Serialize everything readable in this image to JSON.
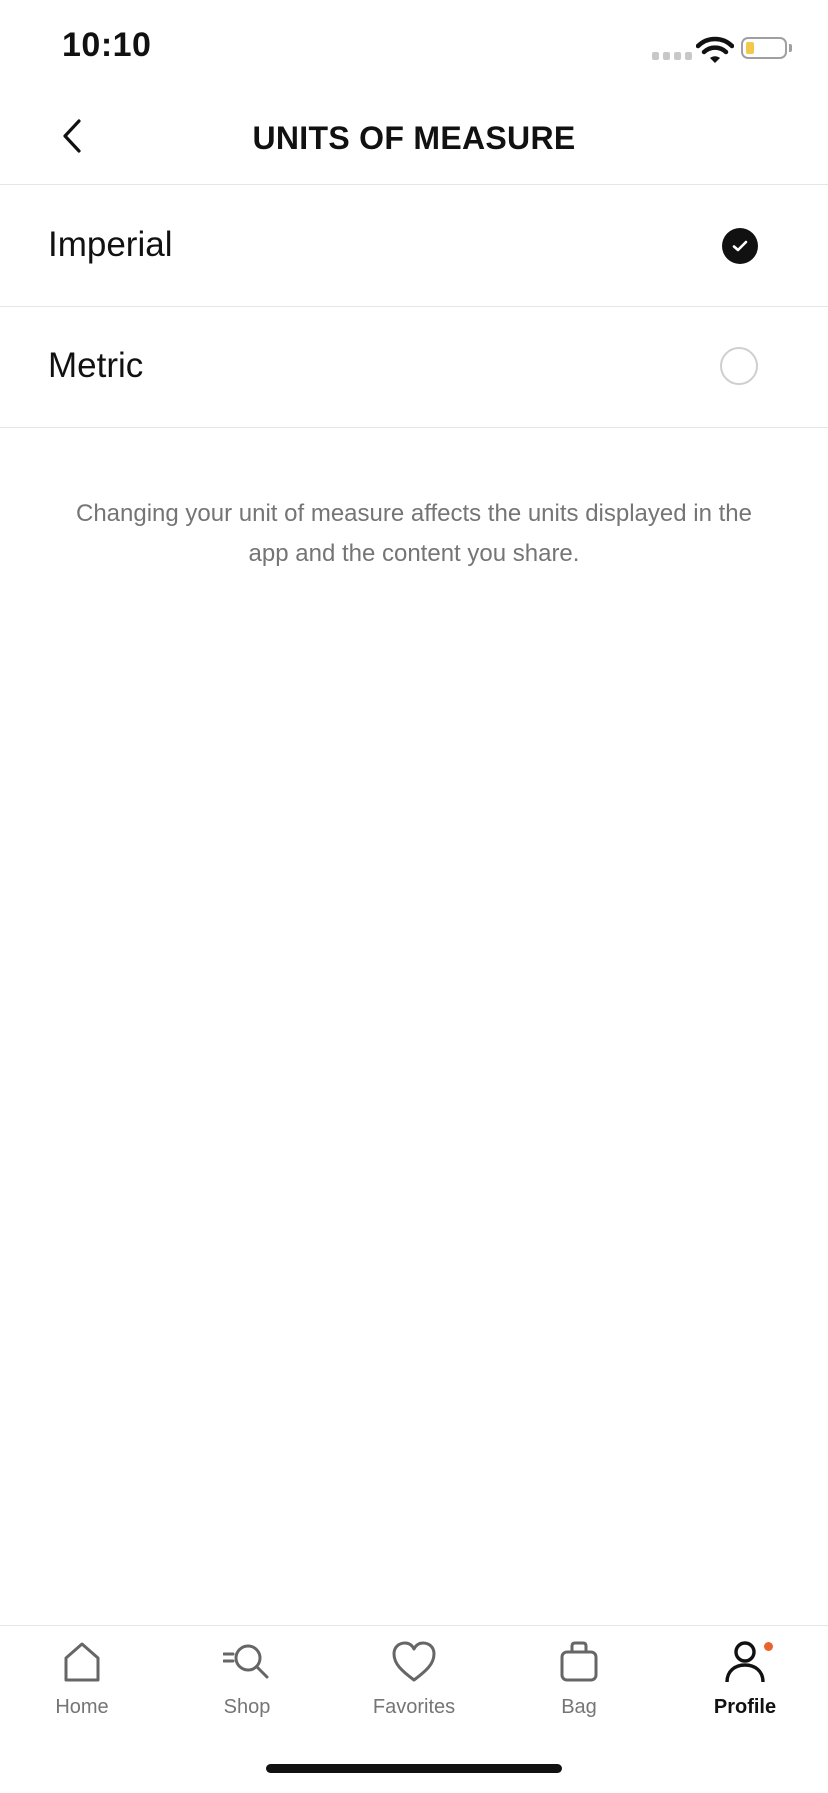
{
  "status_bar": {
    "time": "10:10",
    "battery_color": "#f2c94c"
  },
  "header": {
    "title": "UNITS OF MEASURE",
    "back_icon": "chevron-left-icon"
  },
  "options": [
    {
      "label": "Imperial",
      "selected": true
    },
    {
      "label": "Metric",
      "selected": false
    }
  ],
  "info": {
    "text": "Changing your unit of measure affects the units displayed in the app and the content you share."
  },
  "tab_bar": {
    "active": "Profile",
    "notification_color": "#e8642a",
    "tabs": [
      {
        "label": "Home",
        "icon": "home-icon"
      },
      {
        "label": "Shop",
        "icon": "search-icon"
      },
      {
        "label": "Favorites",
        "icon": "heart-icon"
      },
      {
        "label": "Bag",
        "icon": "bag-icon"
      },
      {
        "label": "Profile",
        "icon": "person-icon"
      }
    ]
  }
}
